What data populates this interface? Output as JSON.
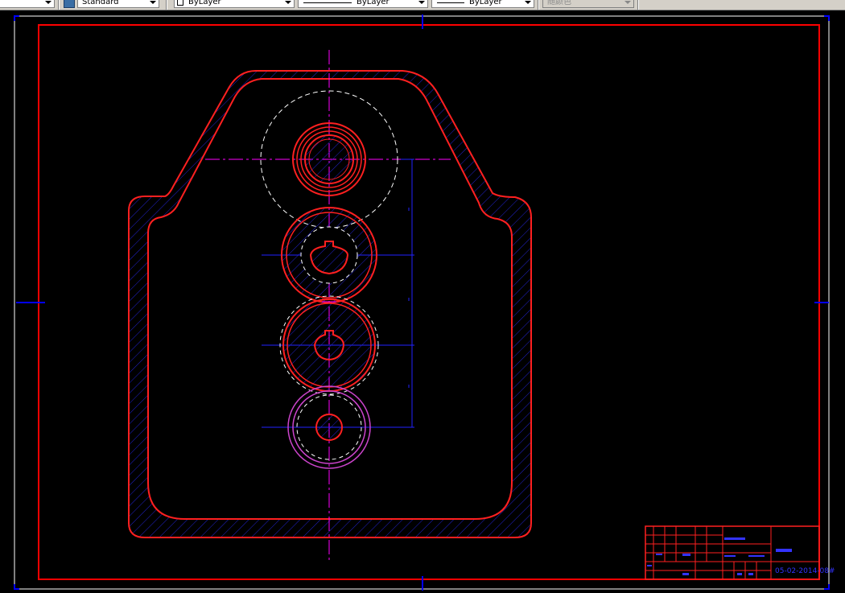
{
  "toolbar": {
    "text_style": "Standard",
    "color": "ByLayer",
    "linetype": "ByLayer",
    "lineweight": "ByLayer",
    "plot_style": "随颜色"
  },
  "colors": {
    "background": "#000000",
    "border": "#ff0000",
    "part_outline": "#ff2020",
    "hatch": "#2222cc",
    "centerline": "#ff00ff",
    "dimension": "#2222ff",
    "hidden": "#ffffff",
    "gear4": "#cc44cc",
    "title_text": "#3333ff"
  },
  "title_block": {
    "drawing_number": "05-02-2014-08#"
  }
}
